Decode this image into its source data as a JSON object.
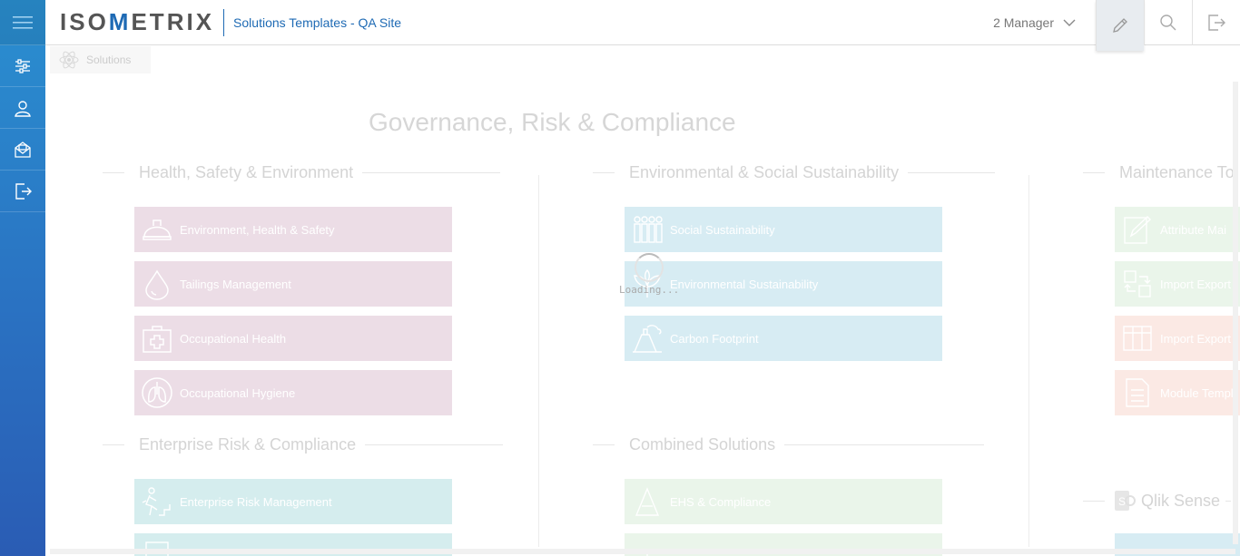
{
  "app": {
    "logo_left": "ISO",
    "logo_mid": "M",
    "logo_right": "ETRIX",
    "site_title": "Solutions Templates - QA Site"
  },
  "sidebar": {
    "items": [
      {
        "icon": "hamburger-menu-icon"
      },
      {
        "icon": "sliders-icon"
      },
      {
        "icon": "user-icon"
      },
      {
        "icon": "mail-icon"
      },
      {
        "icon": "logout-icon"
      }
    ]
  },
  "topbar": {
    "role": "2 Manager",
    "icons": [
      "pencil-icon",
      "search-icon",
      "exit-icon"
    ]
  },
  "breadcrumb": {
    "label": "Solutions"
  },
  "page": {
    "title": "Governance, Risk & Compliance"
  },
  "loading": {
    "text": "Loading..."
  },
  "sections": {
    "hse": {
      "title": "Health, Safety & Environment",
      "tiles": [
        {
          "label": "Environment, Health & Safety",
          "icon": "hard-hat-icon"
        },
        {
          "label": "Tailings Management",
          "icon": "droplet-icon"
        },
        {
          "label": "Occupational Health",
          "icon": "first-aid-kit-icon"
        },
        {
          "label": "Occupational Hygiene",
          "icon": "lungs-icon"
        }
      ]
    },
    "ess": {
      "title": "Environmental & Social Sustainability",
      "tiles": [
        {
          "label": "Social Sustainability",
          "icon": "people-group-icon"
        },
        {
          "label": "Environmental Sustainability",
          "icon": "plant-icon"
        },
        {
          "label": "Carbon Footprint",
          "icon": "factory-icon"
        }
      ]
    },
    "maint": {
      "title": "Maintenance To",
      "tiles": [
        {
          "label": "Attribute Mai",
          "icon": "edit-form-icon"
        },
        {
          "label": "Import Export",
          "icon": "transfer-icon"
        },
        {
          "label": "Import Export",
          "icon": "table-icon"
        },
        {
          "label": "Module Templ",
          "icon": "document-icon"
        }
      ]
    },
    "erc": {
      "title": "Enterprise Risk & Compliance",
      "tiles": [
        {
          "label": "Enterprise Risk Management",
          "icon": "running-man-stairs-icon"
        },
        {
          "label": "",
          "icon": "document-icon"
        }
      ]
    },
    "combined": {
      "title": "Combined Solutions",
      "tiles": [
        {
          "label": "EHS & Compliance",
          "icon": "triangle-icon"
        },
        {
          "label": "",
          "icon": "leaf-icon"
        }
      ]
    },
    "qlik": {
      "title": "Qlik Sense"
    }
  }
}
